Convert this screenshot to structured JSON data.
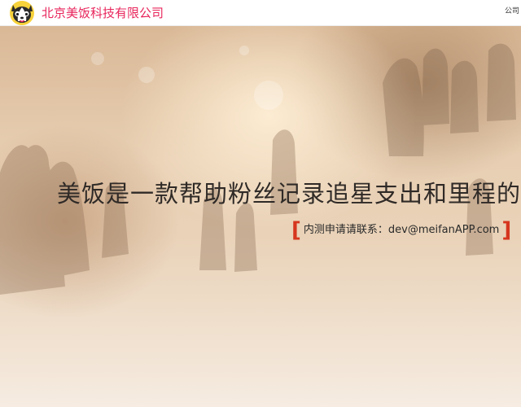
{
  "header": {
    "company_name": "北京美饭科技有限公司",
    "nav_link": "公司"
  },
  "hero": {
    "headline": "美饭是一款帮助粉丝记录追星支出和里程的工",
    "contact_text": "内测申请请联系：dev@meifanAPP.com",
    "bracket_open": "[",
    "bracket_close": "]"
  },
  "colors": {
    "brand": "#e8265c",
    "bracket": "#d6361f",
    "headline": "#2f2a27"
  }
}
